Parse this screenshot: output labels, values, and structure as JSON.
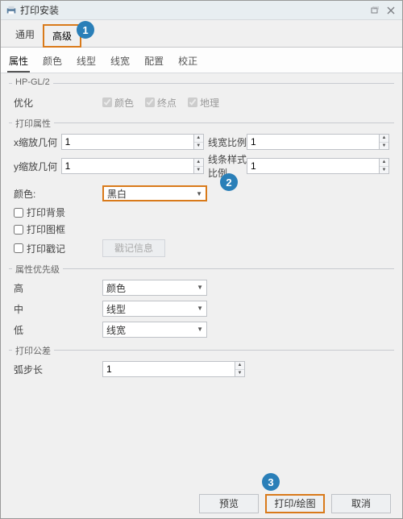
{
  "window": {
    "title": "打印安装"
  },
  "topTabs": {
    "general": "通用",
    "advanced": "高级"
  },
  "subTabs": [
    "属性",
    "颜色",
    "线型",
    "线宽",
    "配置",
    "校正"
  ],
  "groups": {
    "hpgl": {
      "title": "HP-GL/2",
      "optimizeLabel": "优化",
      "cb_color": "颜色",
      "cb_endpoint": "终点",
      "cb_geo": "地理"
    },
    "printProps": {
      "title": "打印属性",
      "xscale": "x缩放几何",
      "yscale": "y缩放几何",
      "colorLabel": "颜色:",
      "lineWidthRatio": "线宽比例",
      "lineStyleRatio": "线条样式比例",
      "colorValue": "黑白",
      "val1": "1",
      "cb_bg": "打印背景",
      "cb_frame": "打印图框",
      "cb_mark": "打印戳记",
      "markBtn": "戳记信息"
    },
    "priority": {
      "title": "属性优先级",
      "high": "高",
      "mid": "中",
      "low": "低",
      "highVal": "颜色",
      "midVal": "线型",
      "lowVal": "线宽"
    },
    "tolerance": {
      "title": "打印公差",
      "arcLabel": "弧步长",
      "arcVal": "1"
    }
  },
  "buttons": {
    "preview": "预览",
    "print": "打印/绘图",
    "cancel": "取消"
  },
  "callouts": {
    "c1": "1",
    "c2": "2",
    "c3": "3"
  }
}
